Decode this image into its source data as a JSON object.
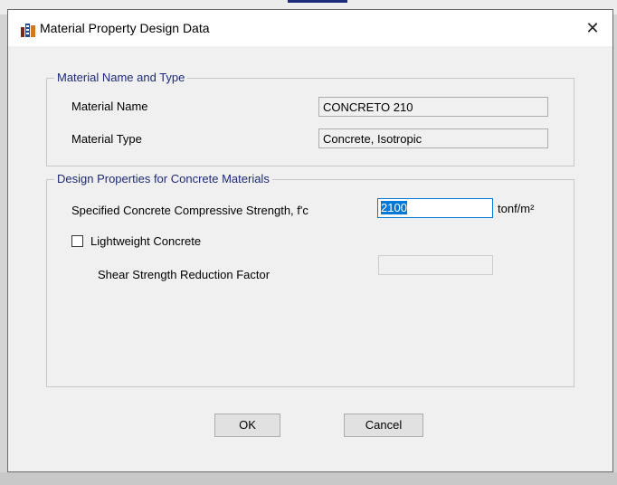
{
  "window": {
    "title": "Material Property Design Data",
    "close_glyph": "✕"
  },
  "name_type_group": {
    "legend": "Material Name and Type",
    "material_name_label": "Material Name",
    "material_name_value": "CONCRETO 210",
    "material_type_label": "Material Type",
    "material_type_value": "Concrete, Isotropic"
  },
  "design_group": {
    "legend": "Design Properties for Concrete Materials",
    "fc_label": "Specified Concrete Compressive Strength, f'c",
    "fc_value": "2100",
    "fc_unit": "tonf/m²",
    "lightweight_label": "Lightweight Concrete",
    "lightweight_checked": false,
    "shear_label": "Shear Strength Reduction Factor",
    "shear_value": ""
  },
  "buttons": {
    "ok": "OK",
    "cancel": "Cancel"
  },
  "colors": {
    "group_title": "#1e2a78",
    "selection": "#0078d7"
  }
}
